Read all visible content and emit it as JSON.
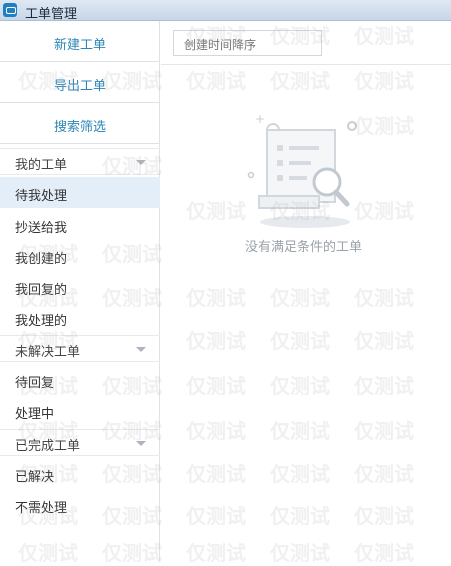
{
  "window": {
    "title": "工单管理",
    "icon": "ticket-app-icon"
  },
  "sidebar": {
    "actions": [
      {
        "label": "新建工单"
      },
      {
        "label": "导出工单"
      },
      {
        "label": "搜索筛选"
      }
    ],
    "groups": [
      {
        "label": "我的工单",
        "items": [
          {
            "label": "待我处理",
            "active": true
          },
          {
            "label": "抄送给我"
          },
          {
            "label": "我创建的"
          },
          {
            "label": "我回复的"
          },
          {
            "label": "我处理的"
          }
        ]
      },
      {
        "label": "未解决工单",
        "items": [
          {
            "label": "待回复"
          },
          {
            "label": "处理中"
          }
        ]
      },
      {
        "label": "已完成工单",
        "items": [
          {
            "label": "已解决"
          },
          {
            "label": "不需处理"
          }
        ]
      }
    ]
  },
  "toolbar": {
    "sort_value": "创建时间降序"
  },
  "empty": {
    "message": "没有满足条件的工单",
    "icon": "empty-document-search-icon"
  },
  "watermark": {
    "text": "仅测试"
  },
  "colors": {
    "accent": "#2b86b8",
    "active_bg": "#e3eef8",
    "titlebar": "#c7d6e8"
  }
}
